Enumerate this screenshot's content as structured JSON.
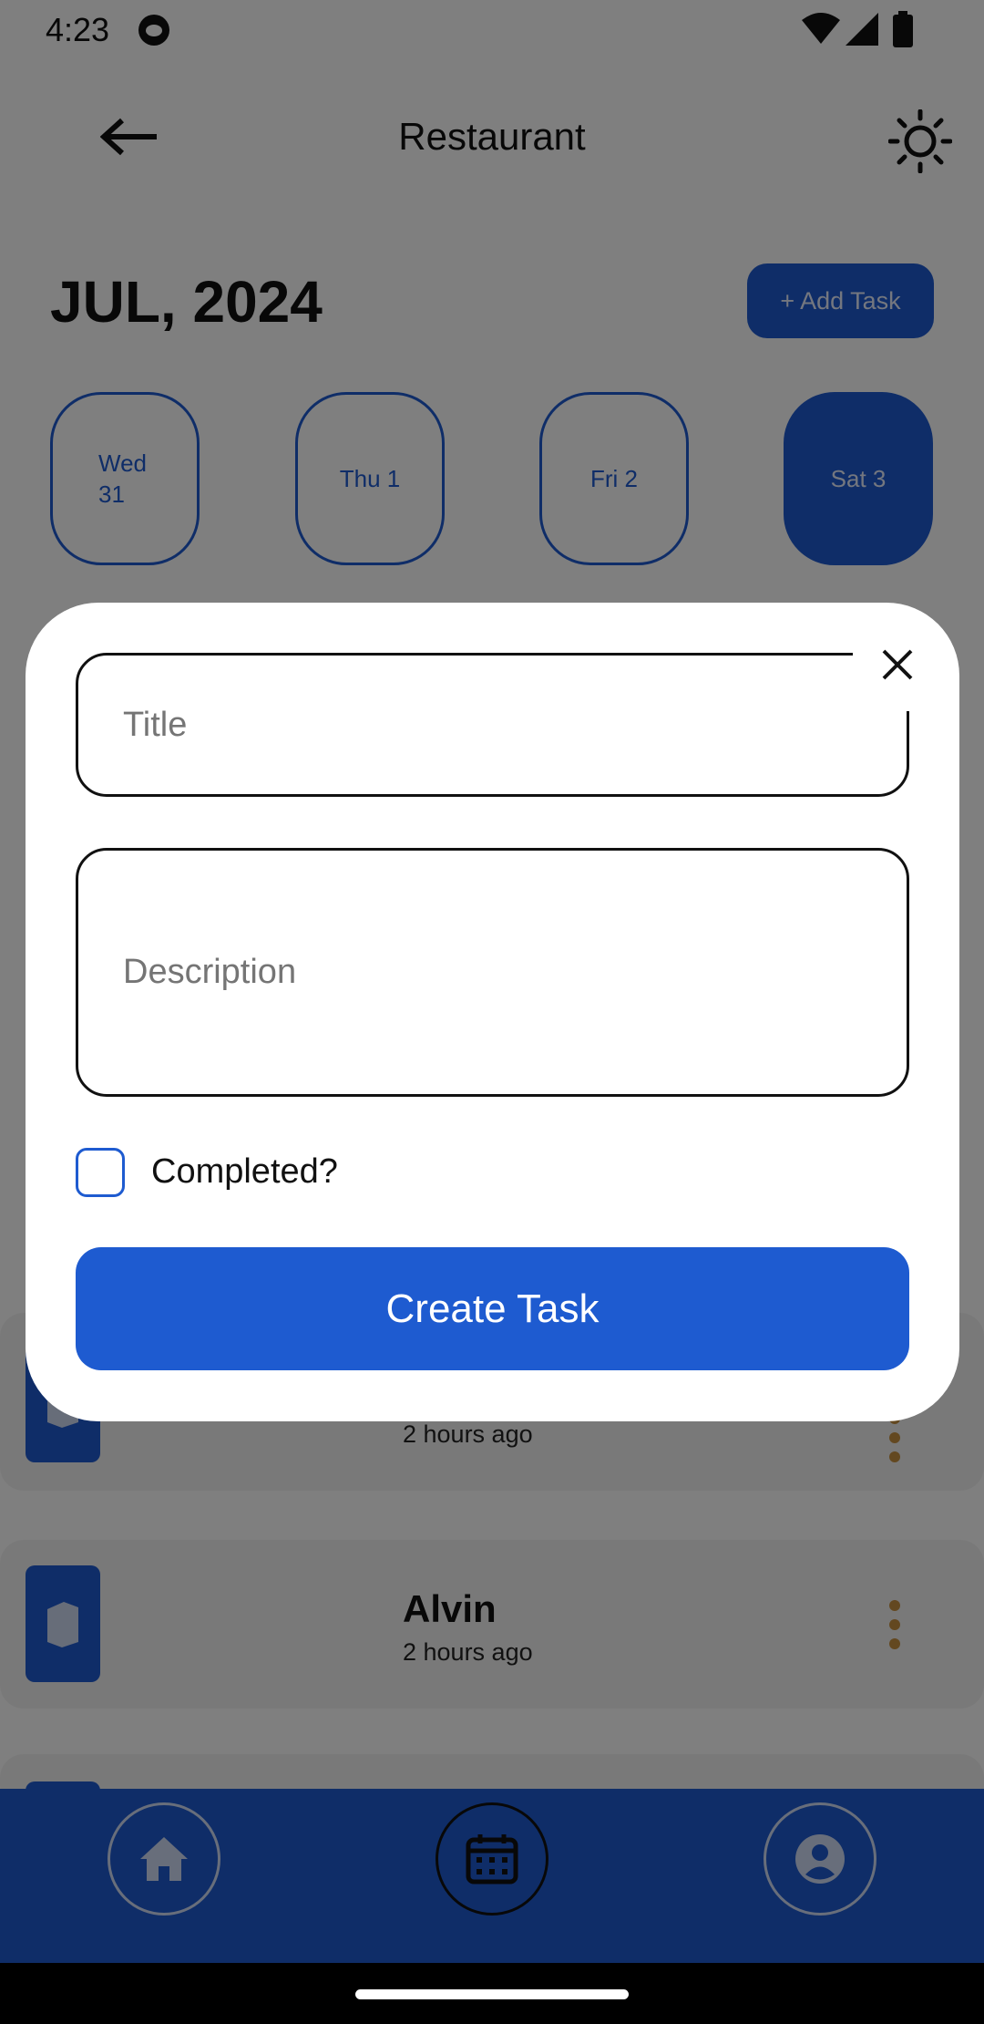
{
  "status_bar": {
    "time": "4:23"
  },
  "app_bar": {
    "title": "Restaurant"
  },
  "calendar": {
    "month": "JUL, 2024",
    "add_task_label": "+ Add Task",
    "days": [
      {
        "line1": "Wed",
        "line2": "31",
        "selected": false
      },
      {
        "line1": "Thu 1",
        "line2": "",
        "selected": false
      },
      {
        "line1": "Fri 2",
        "line2": "",
        "selected": false
      },
      {
        "line1": "Sat 3",
        "line2": "",
        "selected": true
      }
    ]
  },
  "tasks": [
    {
      "name": "",
      "time": "2 hours ago"
    },
    {
      "name": "Alvin",
      "time": "2 hours ago"
    }
  ],
  "modal": {
    "title_placeholder": "Title",
    "description_placeholder": "Description",
    "checkbox_label": "Completed?",
    "checkbox_checked": false,
    "submit_label": "Create Task"
  },
  "colors": {
    "accent": "#1e5bd0",
    "menu_dots": "#c79040"
  }
}
